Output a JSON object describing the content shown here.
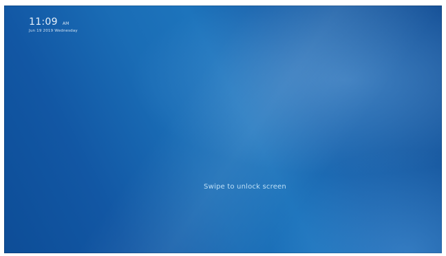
{
  "lock_screen": {
    "time": "11:09",
    "ampm": "AM",
    "date": "Jun 19 2019 Wednesday",
    "unlock_hint": "Swipe to unlock screen"
  },
  "colors": {
    "background_primary": "#1a6db6",
    "background_dark": "#0d4d97",
    "text_light": "#e9f2fb",
    "hint_text": "#bfe0f7"
  }
}
